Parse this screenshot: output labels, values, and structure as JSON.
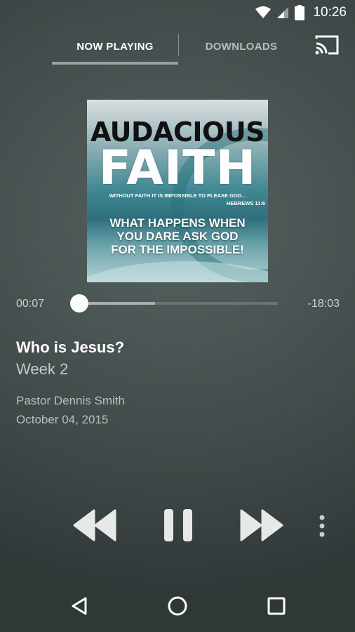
{
  "status_bar": {
    "time": "10:26"
  },
  "tabs": [
    {
      "label": "NOW PLAYING",
      "active": true
    },
    {
      "label": "DOWNLOADS",
      "active": false
    }
  ],
  "album_art": {
    "title_line1": "AUDACIOUS",
    "title_line2": "FAITH",
    "verse": "WITHOUT FAITH IT IS IMPOSSIBLE TO PLEASE GOD...",
    "verse_ref": "HEBREWS 11:6",
    "tagline_line1": "WHAT HAPPENS WHEN",
    "tagline_line2": "YOU DARE ASK GOD",
    "tagline_line3": "FOR THE IMPOSSIBLE!"
  },
  "player": {
    "elapsed": "00:07",
    "remaining": "-18:03",
    "buffered_fraction": 0.38,
    "played_fraction": 0.0
  },
  "track": {
    "title": "Who is Jesus?",
    "subtitle": "Week 2",
    "speaker": "Pastor Dennis Smith",
    "date": "October 04, 2015"
  },
  "controls": [
    "rewind-icon",
    "pause-icon",
    "fast-forward-icon",
    "more-vert-icon"
  ],
  "nav": [
    "back-icon",
    "home-icon",
    "recents-icon"
  ],
  "colors": {
    "background": "#4a5453",
    "accent": "#ffffff",
    "indicator": "#9aa1a0"
  }
}
